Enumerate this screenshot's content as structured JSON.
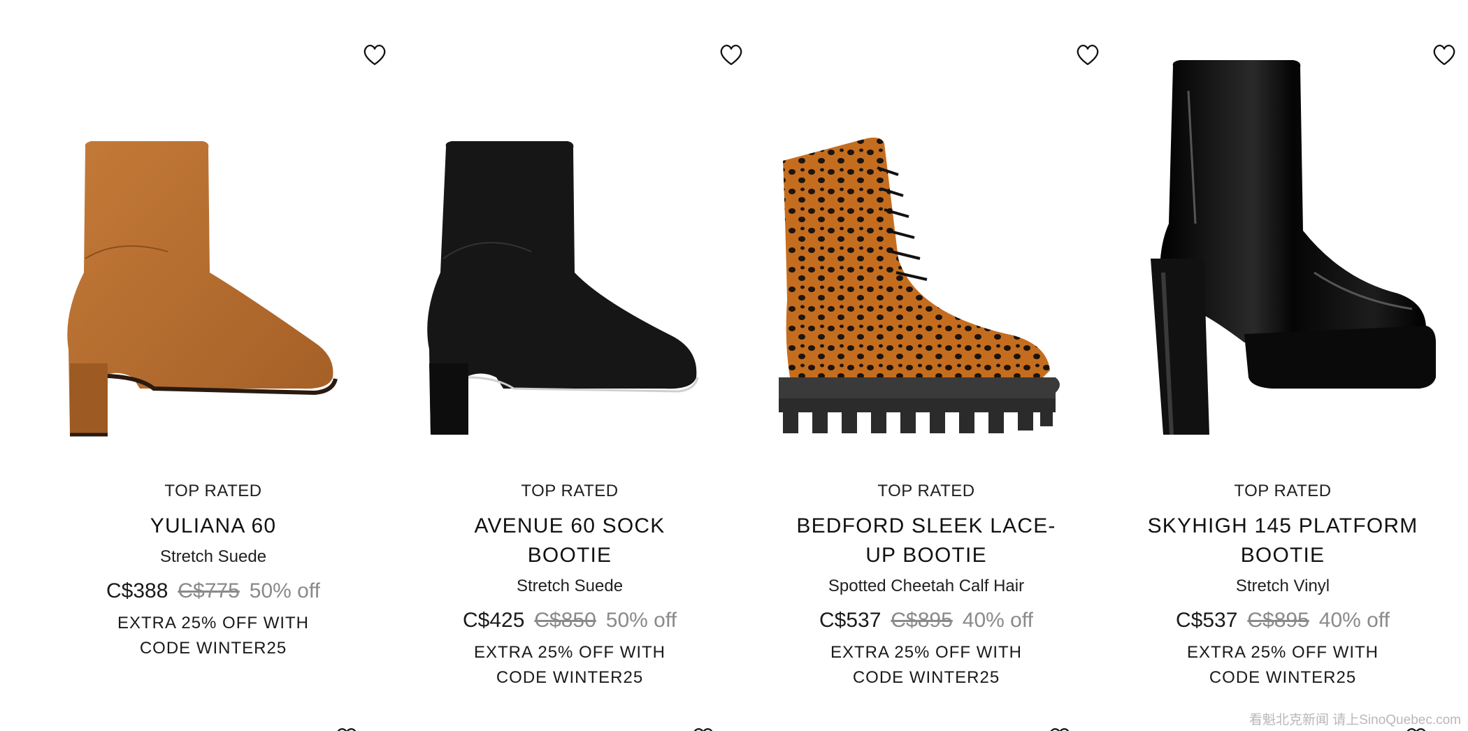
{
  "products": [
    {
      "badge": "TOP RATED",
      "name": "YULIANA 60",
      "material": "Stretch Suede",
      "price": "C$388",
      "original_price": "C$775",
      "discount": "50% off",
      "promo_line1": "EXTRA 25% OFF WITH",
      "promo_line2": "CODE WINTER25",
      "color": "#b0682d",
      "image_icon": "tan-suede-ankle-boot"
    },
    {
      "badge": "TOP RATED",
      "name": "AVENUE 60 SOCK BOOTIE",
      "material": "Stretch Suede",
      "price": "C$425",
      "original_price": "C$850",
      "discount": "50% off",
      "promo_line1": "EXTRA 25% OFF WITH",
      "promo_line2": "CODE WINTER25",
      "color": "#151515",
      "image_icon": "black-suede-sock-bootie"
    },
    {
      "badge": "TOP RATED",
      "name": "BEDFORD SLEEK LACE-UP BOOTIE",
      "material": "Spotted Cheetah Calf Hair",
      "price": "C$537",
      "original_price": "C$895",
      "discount": "40% off",
      "promo_line1": "EXTRA 25% OFF WITH",
      "promo_line2": "CODE WINTER25",
      "color": "#c26a1e",
      "image_icon": "cheetah-lace-up-boot"
    },
    {
      "badge": "TOP RATED",
      "name": "SKYHIGH 145 PLATFORM BOOTIE",
      "material": "Stretch Vinyl",
      "price": "C$537",
      "original_price": "C$895",
      "discount": "40% off",
      "promo_line1": "EXTRA 25% OFF WITH",
      "promo_line2": "CODE WINTER25",
      "color": "#0a0a0a",
      "image_icon": "black-vinyl-platform-bootie"
    }
  ],
  "wishlist_icon": "heart-outline-icon",
  "watermark": "看魁北克新闻 请上SinoQuebec.com"
}
